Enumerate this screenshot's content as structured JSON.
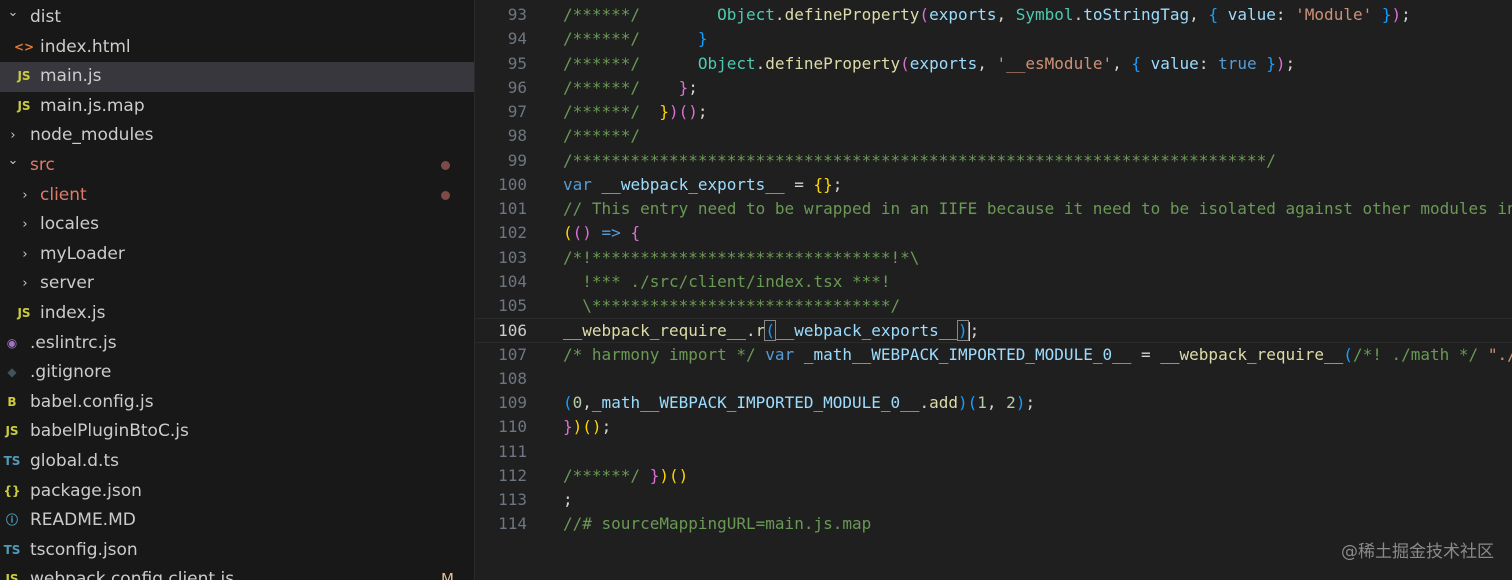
{
  "explorer": {
    "items": [
      {
        "label": "dist",
        "kind": "folder-open",
        "depth": 0,
        "icon": "chevron-down-icon",
        "state": "normal"
      },
      {
        "label": "index.html",
        "kind": "file",
        "depth": 1,
        "icon": "html-icon",
        "glyph": "<>",
        "iconColor": "#e37933",
        "state": "normal"
      },
      {
        "label": "main.js",
        "kind": "file",
        "depth": 1,
        "icon": "js-icon",
        "glyph": "JS",
        "iconColor": "#cbcb41",
        "state": "selected"
      },
      {
        "label": "main.js.map",
        "kind": "file",
        "depth": 1,
        "icon": "js-icon",
        "glyph": "JS",
        "iconColor": "#cbcb41",
        "state": "normal"
      },
      {
        "label": "node_modules",
        "kind": "folder",
        "depth": 0,
        "icon": "chevron-right-icon",
        "state": "normal"
      },
      {
        "label": "src",
        "kind": "folder-open",
        "depth": 0,
        "icon": "chevron-down-icon",
        "state": "modified",
        "labelColor": "#e07a6c"
      },
      {
        "label": "client",
        "kind": "folder",
        "depth": 1,
        "icon": "chevron-right-icon",
        "state": "modified",
        "labelColor": "#e07a6c"
      },
      {
        "label": "locales",
        "kind": "folder",
        "depth": 1,
        "icon": "chevron-right-icon",
        "state": "normal"
      },
      {
        "label": "myLoader",
        "kind": "folder",
        "depth": 1,
        "icon": "chevron-right-icon",
        "state": "normal"
      },
      {
        "label": "server",
        "kind": "folder",
        "depth": 1,
        "icon": "chevron-right-icon",
        "state": "normal"
      },
      {
        "label": "index.js",
        "kind": "file",
        "depth": 1,
        "icon": "js-icon",
        "glyph": "JS",
        "iconColor": "#cbcb41",
        "state": "normal"
      },
      {
        "label": ".eslintrc.js",
        "kind": "file",
        "depth": 0,
        "icon": "eslint-icon",
        "glyph": "◉",
        "iconColor": "#a074c4",
        "state": "normal"
      },
      {
        "label": ".gitignore",
        "kind": "file",
        "depth": 0,
        "icon": "git-icon",
        "glyph": "◆",
        "iconColor": "#41535b",
        "state": "normal"
      },
      {
        "label": "babel.config.js",
        "kind": "file",
        "depth": 0,
        "icon": "babel-icon",
        "glyph": "B",
        "iconColor": "#cbcb41",
        "state": "normal"
      },
      {
        "label": "babelPluginBtoC.js",
        "kind": "file",
        "depth": 0,
        "icon": "js-icon",
        "glyph": "JS",
        "iconColor": "#cbcb41",
        "state": "normal"
      },
      {
        "label": "global.d.ts",
        "kind": "file",
        "depth": 0,
        "icon": "ts-icon",
        "glyph": "TS",
        "iconColor": "#519aba",
        "state": "normal"
      },
      {
        "label": "package.json",
        "kind": "file",
        "depth": 0,
        "icon": "json-icon",
        "glyph": "{}",
        "iconColor": "#cbcb41",
        "state": "normal"
      },
      {
        "label": "README.MD",
        "kind": "file",
        "depth": 0,
        "icon": "info-icon",
        "glyph": "ⓘ",
        "iconColor": "#519aba",
        "state": "normal"
      },
      {
        "label": "tsconfig.json",
        "kind": "file",
        "depth": 0,
        "icon": "tsconfig-icon",
        "glyph": "TS",
        "iconColor": "#519aba",
        "state": "normal"
      },
      {
        "label": "webpack.config.client.js",
        "kind": "file",
        "depth": 0,
        "icon": "js-icon",
        "glyph": "JS",
        "iconColor": "#cbcb41",
        "state": "git-modified",
        "badge": "M"
      }
    ]
  },
  "editor": {
    "current_line": 106,
    "lines": [
      {
        "n": "93",
        "tokens": [
          [
            "c",
            "/******/"
          ],
          [
            "p",
            "        "
          ],
          [
            "cls",
            "Object"
          ],
          [
            "p",
            "."
          ],
          [
            "fn",
            "defineProperty"
          ],
          [
            "p2",
            "("
          ],
          [
            "v",
            "exports"
          ],
          [
            "p",
            ", "
          ],
          [
            "cls",
            "Symbol"
          ],
          [
            "p",
            "."
          ],
          [
            "v",
            "toStringTag"
          ],
          [
            "p",
            ", "
          ],
          [
            "p3",
            "{"
          ],
          [
            "p",
            " "
          ],
          [
            "v",
            "value"
          ],
          [
            "p",
            ": "
          ],
          [
            "s",
            "'Module'"
          ],
          [
            "p",
            " "
          ],
          [
            "p3",
            "}"
          ],
          [
            "p2",
            ")"
          ],
          [
            "p",
            ";"
          ]
        ]
      },
      {
        "n": "94",
        "tokens": [
          [
            "c",
            "/******/"
          ],
          [
            "p",
            "      "
          ],
          [
            "p3",
            "}"
          ]
        ]
      },
      {
        "n": "95",
        "tokens": [
          [
            "c",
            "/******/"
          ],
          [
            "p",
            "      "
          ],
          [
            "cls",
            "Object"
          ],
          [
            "p",
            "."
          ],
          [
            "fn",
            "defineProperty"
          ],
          [
            "p2",
            "("
          ],
          [
            "v",
            "exports"
          ],
          [
            "p",
            ", "
          ],
          [
            "s",
            "'__esModule'"
          ],
          [
            "p",
            ", "
          ],
          [
            "p3",
            "{"
          ],
          [
            "p",
            " "
          ],
          [
            "v",
            "value"
          ],
          [
            "p",
            ": "
          ],
          [
            "k",
            "true"
          ],
          [
            "p",
            " "
          ],
          [
            "p3",
            "}"
          ],
          [
            "p2",
            ")"
          ],
          [
            "p",
            ";"
          ]
        ]
      },
      {
        "n": "96",
        "tokens": [
          [
            "c",
            "/******/"
          ],
          [
            "p",
            "    "
          ],
          [
            "p2",
            "}"
          ],
          [
            "p",
            ";"
          ]
        ]
      },
      {
        "n": "97",
        "tokens": [
          [
            "c",
            "/******/"
          ],
          [
            "p",
            "  "
          ],
          [
            "p1",
            "}"
          ],
          [
            "p2",
            ")"
          ],
          [
            "p2",
            "("
          ],
          [
            "p2",
            ")"
          ],
          [
            "p",
            ";"
          ]
        ]
      },
      {
        "n": "98",
        "tokens": [
          [
            "c",
            "/******/"
          ]
        ]
      },
      {
        "n": "99",
        "tokens": [
          [
            "c",
            "/************************************************************************/"
          ]
        ]
      },
      {
        "n": "100",
        "tokens": [
          [
            "k",
            "var"
          ],
          [
            "p",
            " "
          ],
          [
            "v",
            "__webpack_exports__"
          ],
          [
            "p",
            " = "
          ],
          [
            "p1",
            "{}"
          ],
          [
            "p",
            ";"
          ]
        ]
      },
      {
        "n": "101",
        "tokens": [
          [
            "c",
            "// This entry need to be wrapped in an IIFE because it need to be isolated against other modules in the chunk."
          ]
        ]
      },
      {
        "n": "102",
        "tokens": [
          [
            "p1",
            "("
          ],
          [
            "p2",
            "()"
          ],
          [
            "p",
            " "
          ],
          [
            "k",
            "=>"
          ],
          [
            "p",
            " "
          ],
          [
            "p2",
            "{"
          ]
        ]
      },
      {
        "n": "103",
        "tokens": [
          [
            "c",
            "/*!*******************************!*\\"
          ]
        ]
      },
      {
        "n": "104",
        "tokens": [
          [
            "c",
            "  !*** ./src/client/index.tsx ***!"
          ]
        ]
      },
      {
        "n": "105",
        "tokens": [
          [
            "c",
            "  \\*******************************/"
          ]
        ]
      },
      {
        "n": "106",
        "tokens": [
          [
            "fn",
            "__webpack_require__"
          ],
          [
            "p",
            "."
          ],
          [
            "fn",
            "r"
          ],
          [
            "p3m",
            "("
          ],
          [
            "v",
            "__webpack_exports__"
          ],
          [
            "p3m",
            ")"
          ],
          [
            "cur",
            ""
          ],
          [
            "p",
            ";"
          ]
        ]
      },
      {
        "n": "107",
        "tokens": [
          [
            "c",
            "/* harmony import */"
          ],
          [
            "p",
            " "
          ],
          [
            "k",
            "var"
          ],
          [
            "p",
            " "
          ],
          [
            "v",
            "_math__WEBPACK_IMPORTED_MODULE_0__"
          ],
          [
            "p",
            " = "
          ],
          [
            "fn",
            "__webpack_require__"
          ],
          [
            "p3",
            "("
          ],
          [
            "c",
            "/*! ./math */"
          ],
          [
            "p",
            " "
          ],
          [
            "s",
            "\"./src/client/math.ts\""
          ],
          [
            "p3",
            ")"
          ],
          [
            "p",
            ";"
          ]
        ]
      },
      {
        "n": "108",
        "tokens": []
      },
      {
        "n": "109",
        "tokens": [
          [
            "p3",
            "("
          ],
          [
            "n",
            "0"
          ],
          [
            "p",
            ","
          ],
          [
            "v",
            "_math__WEBPACK_IMPORTED_MODULE_0__"
          ],
          [
            "p",
            "."
          ],
          [
            "fn",
            "add"
          ],
          [
            "p3",
            ")"
          ],
          [
            "p3",
            "("
          ],
          [
            "n",
            "1"
          ],
          [
            "p",
            ", "
          ],
          [
            "n",
            "2"
          ],
          [
            "p3",
            ")"
          ],
          [
            "p",
            ";"
          ]
        ]
      },
      {
        "n": "110",
        "tokens": [
          [
            "p2",
            "}"
          ],
          [
            "p1",
            ")"
          ],
          [
            "p1",
            "("
          ],
          [
            "p1",
            ")"
          ],
          [
            "p",
            ";"
          ]
        ]
      },
      {
        "n": "111",
        "tokens": []
      },
      {
        "n": "112",
        "tokens": [
          [
            "c",
            "/******/"
          ],
          [
            "p",
            " "
          ],
          [
            "p2",
            "}"
          ],
          [
            "p1",
            ")"
          ],
          [
            "p1",
            "("
          ],
          [
            "p1",
            ")"
          ]
        ]
      },
      {
        "n": "113",
        "tokens": [
          [
            "p",
            ";"
          ]
        ]
      },
      {
        "n": "114",
        "tokens": [
          [
            "c",
            "//# sourceMappingURL=main.js.map"
          ]
        ]
      }
    ]
  },
  "watermark": "@稀土掘金技术社区",
  "colors": {
    "explorer_bg": "#181818",
    "editor_bg": "#1f1f1f",
    "selected_row": "#37373d",
    "modified_label": "#e07a6c",
    "git_modified": "#e2c08d"
  }
}
